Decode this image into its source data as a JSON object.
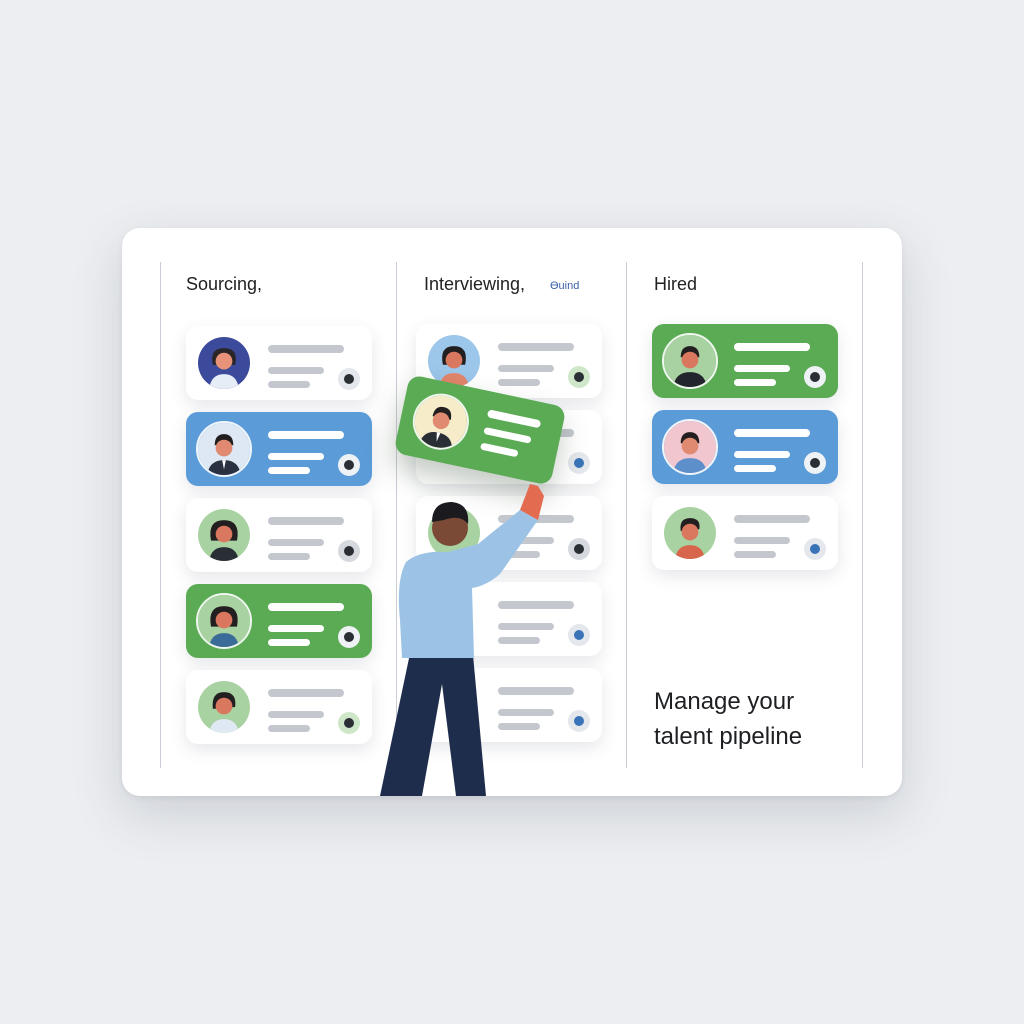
{
  "columns": [
    {
      "title": "Sourcing,"
    },
    {
      "title": "Interviewing,",
      "tag": "Ɵuind"
    },
    {
      "title": "Hired"
    }
  ],
  "tagline": {
    "line1": "Manage your",
    "line2": "talent pipeline"
  },
  "colors": {
    "background": "#eceef1",
    "card_white": "#ffffff",
    "card_blue": "#5b9bd8",
    "card_green": "#5bab55",
    "status_dot_blue": "#3a74b8",
    "status_dot_dark": "#2a2f36"
  },
  "icons": [
    "avatar-icon",
    "status-dot-icon"
  ]
}
